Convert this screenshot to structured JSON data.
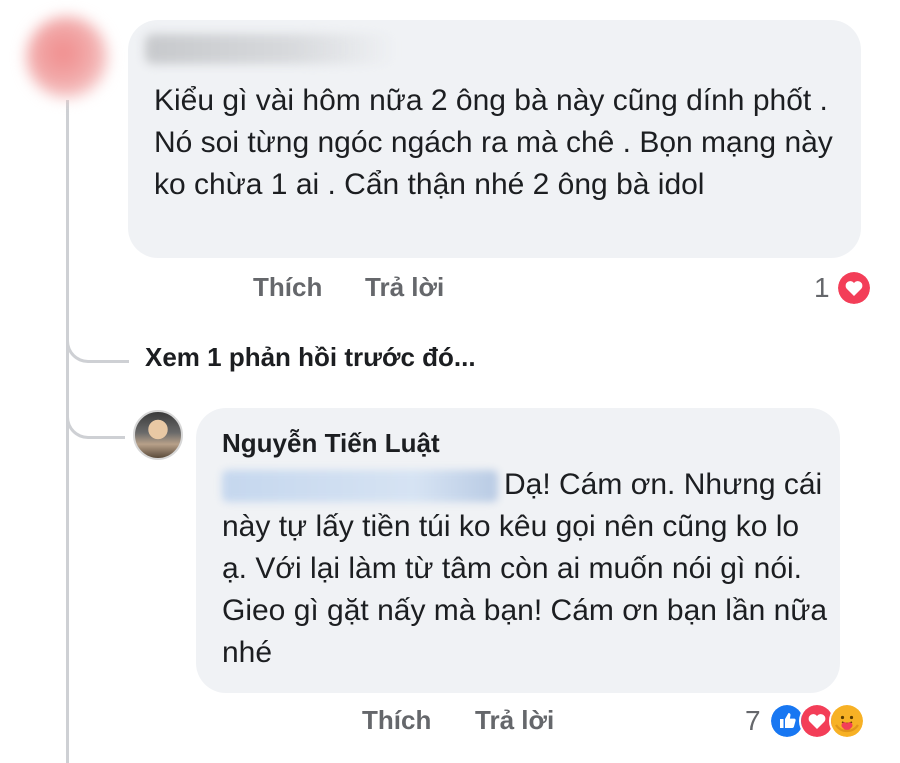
{
  "comment1": {
    "text": "Kiểu gì vài hôm nữa 2 ông bà này cũng dính phốt . Nó soi từng ngóc ngách ra mà chê . Bọn mạng này ko chừa 1 ai . Cẩn thận nhé 2 ông bà idol",
    "like_label": "Thích",
    "reply_label": "Trả lời",
    "reaction_count": "1",
    "reactions": [
      "heart-icon"
    ]
  },
  "view_previous_replies": "Xem 1 phản hồi trước đó...",
  "comment2": {
    "author": "Nguyễn Tiến Luật",
    "text": "Dạ! Cám ơn. Nhưng cái này tự lấy tiền túi ko kêu gọi nên cũng ko lo ạ. Với lại làm từ tâm còn ai muốn nói gì nói. Gieo gì gặt nấy mà bạn! Cám ơn bạn lần nữa nhé",
    "like_label": "Thích",
    "reply_label": "Trả lời",
    "reaction_count": "7",
    "reactions": [
      "like-icon",
      "heart-icon",
      "care-icon"
    ]
  },
  "colors": {
    "bubble": "#f0f2f5",
    "secondary_text": "#65676b",
    "thread_line": "#ced0d4",
    "like_blue": "#1877f2",
    "heart_red": "#f33e58",
    "care_yellow": "#f7b125"
  }
}
